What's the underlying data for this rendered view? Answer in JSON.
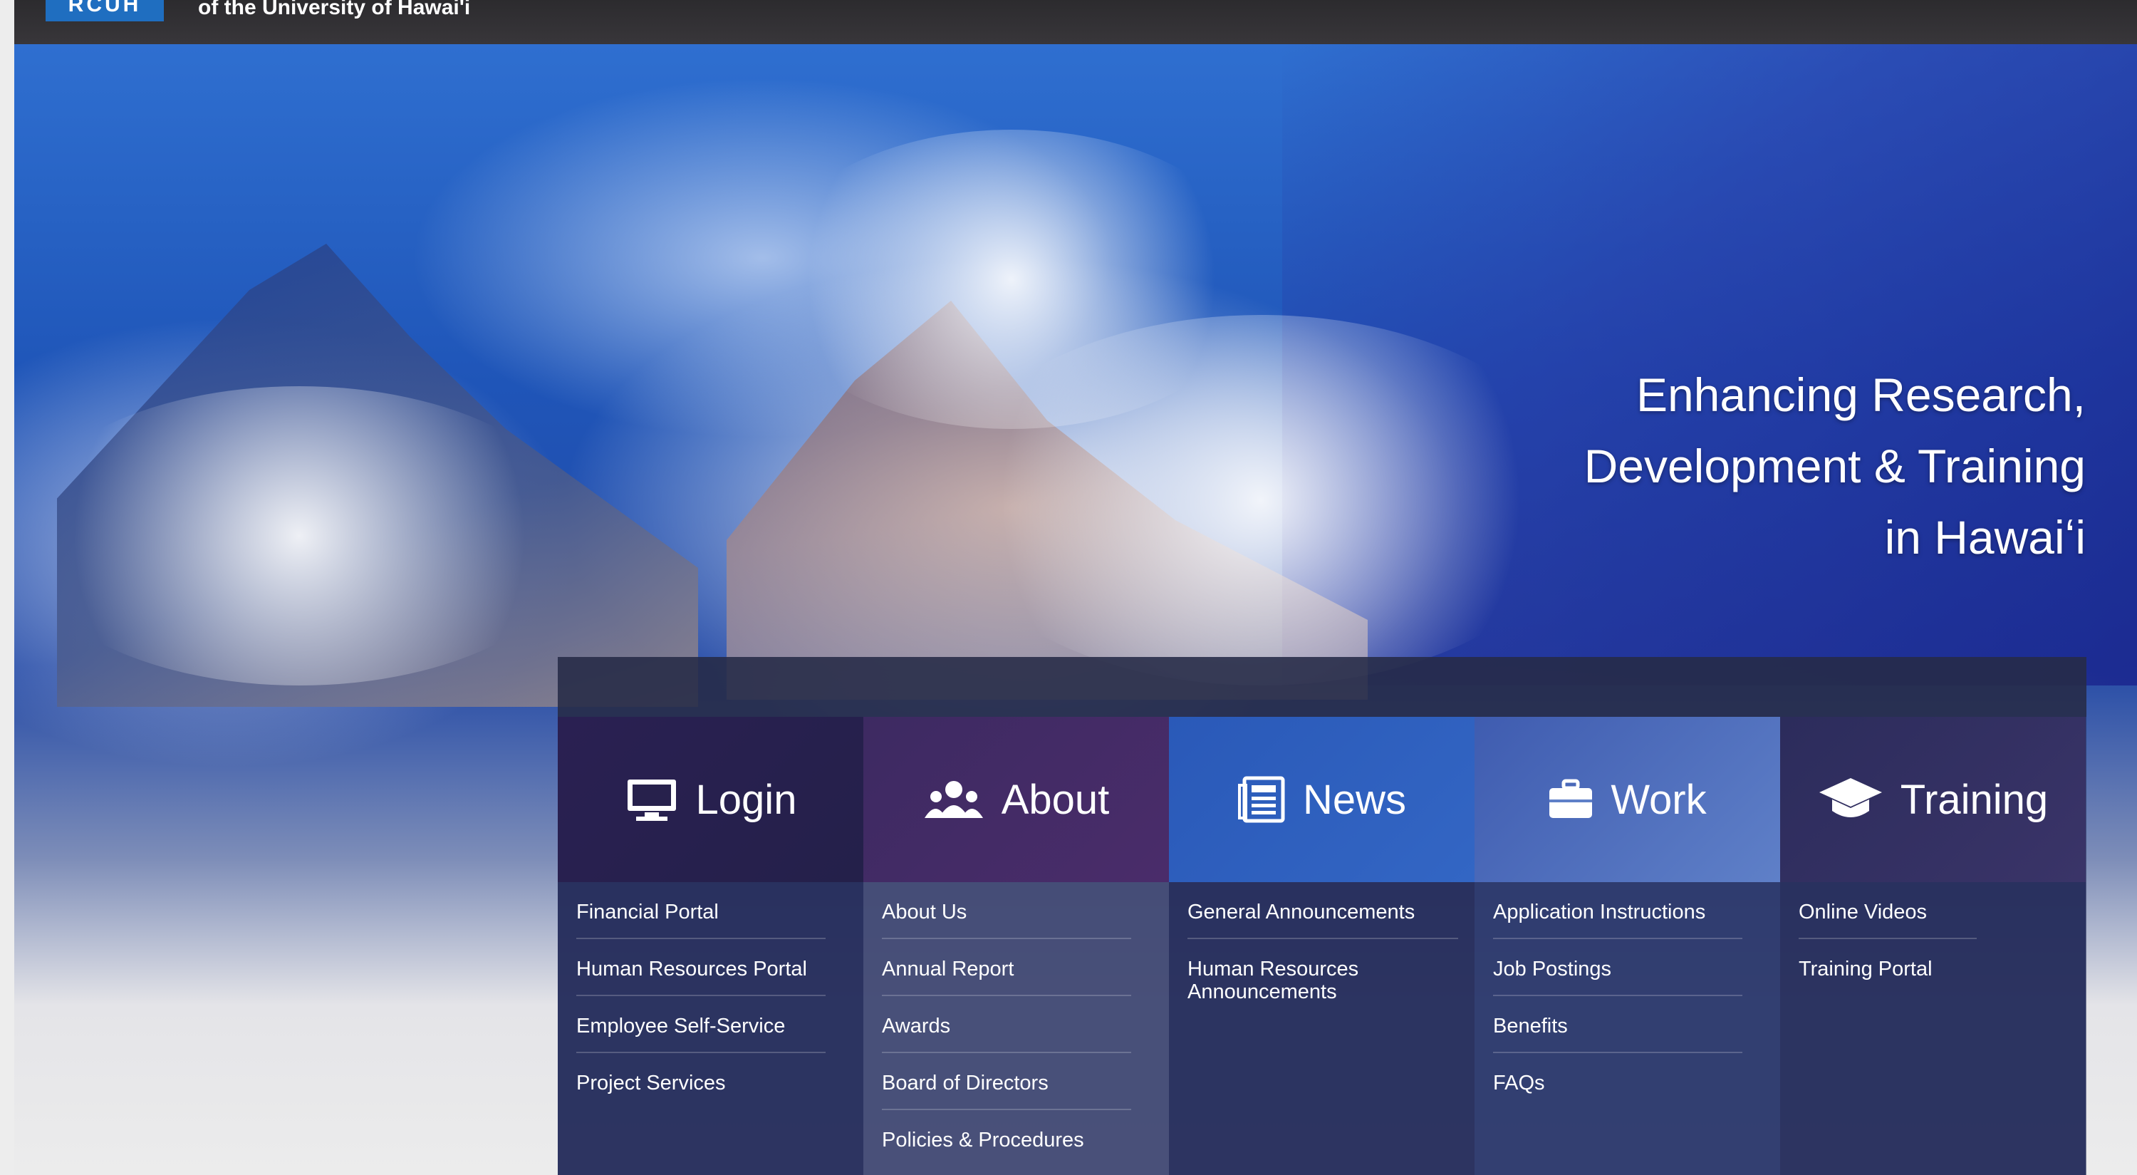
{
  "header": {
    "logo_text": "RCUH",
    "subtitle": "of the University of Hawai'i"
  },
  "hero": {
    "tagline_lines": [
      "Enhancing Research,",
      "Development & Training",
      "in Hawaiʻi"
    ]
  },
  "menu": {
    "columns": [
      {
        "title": "Login",
        "icon": "monitor-icon",
        "items": [
          "Financial Portal",
          "Human Resources Portal",
          "Employee Self-Service",
          "Project Services"
        ]
      },
      {
        "title": "About",
        "icon": "people-icon",
        "items": [
          "About Us",
          "Annual Report",
          "Awards",
          "Board of Directors",
          "Policies & Procedures"
        ]
      },
      {
        "title": "News",
        "icon": "newspaper-icon",
        "items": [
          "General Announcements",
          "Human Resources Announcements"
        ]
      },
      {
        "title": "Work",
        "icon": "briefcase-icon",
        "items": [
          "Application Instructions",
          "Job Postings",
          "Benefits",
          "FAQs"
        ]
      },
      {
        "title": "Training",
        "icon": "graduation-cap-icon",
        "items": [
          "Online Videos",
          "Training Portal"
        ]
      }
    ]
  },
  "colors": {
    "topbar": "#2c2b2e",
    "logo_blue": "#1f6ec0",
    "menu_bg": "#262e5c"
  }
}
